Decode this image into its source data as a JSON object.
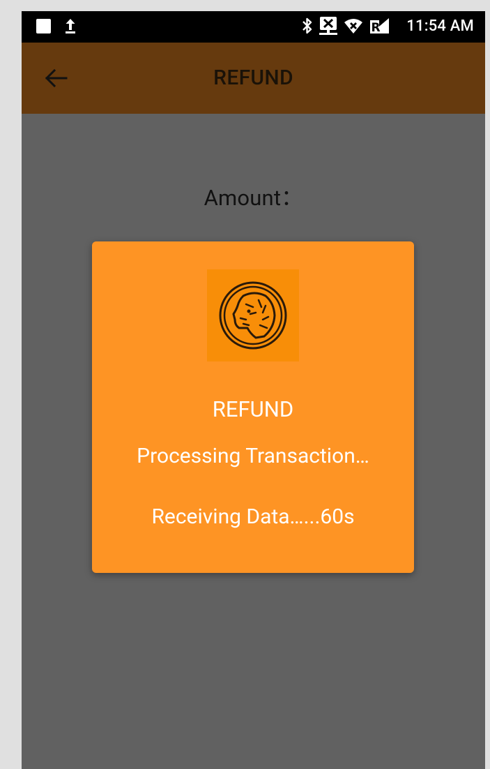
{
  "status_bar": {
    "time": "11:54 AM",
    "left_icons": [
      "stop-square-icon",
      "upload-icon"
    ],
    "right_icons": [
      "bluetooth-icon",
      "network-x-icon",
      "wifi-icon",
      "signal-icon"
    ]
  },
  "app_bar": {
    "title": "REFUND",
    "back_icon": "arrow-left-icon",
    "color": "#663a0e"
  },
  "content": {
    "amount_label": "Amount："
  },
  "dialog": {
    "logo": "tiger-head-logo",
    "title": "REFUND",
    "status": "Processing Transaction…",
    "progress": "Receiving Data…...60s",
    "background": "#fe9424"
  }
}
